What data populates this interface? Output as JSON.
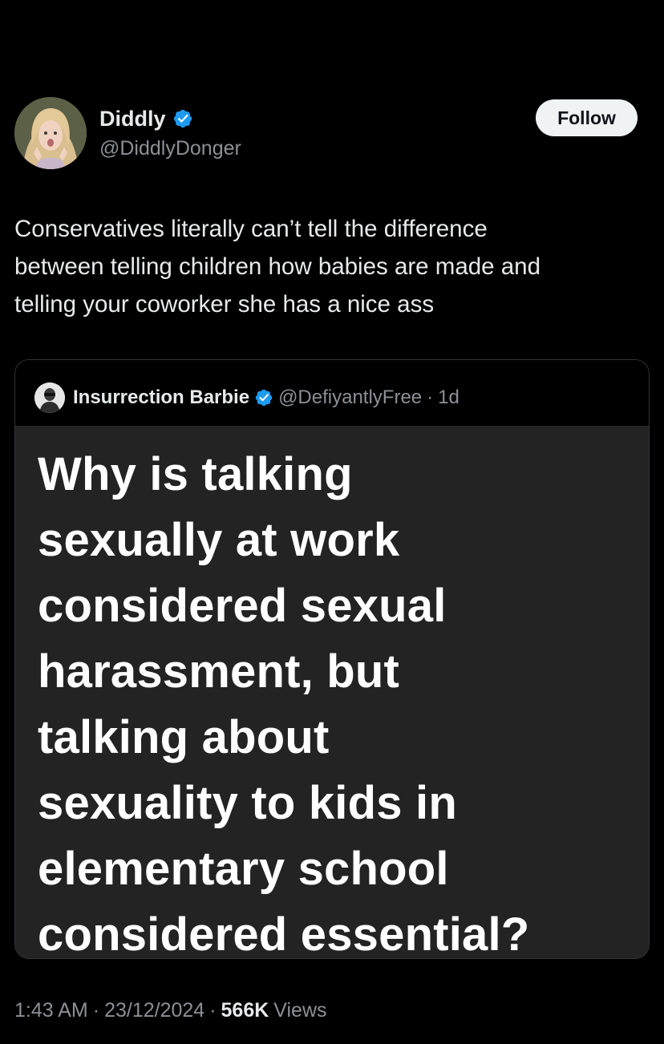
{
  "colors": {
    "background": "#000000",
    "text_primary": "#e7e9ea",
    "text_secondary": "#8b9096",
    "verified_badge": "#1d9bf0",
    "follow_button_bg": "#eff3f4",
    "quote_media_bg": "#232323"
  },
  "author": {
    "name": "Diddly",
    "handle": "@DiddlyDonger",
    "verified": true,
    "avatar_icon": "avatar-photo-icon"
  },
  "follow_button": {
    "label": "Follow"
  },
  "post": {
    "text": "Conservatives literally can’t tell the difference\nbetween telling children how babies are made and\ntelling your coworker she has a nice ass"
  },
  "quote": {
    "author_name": "Insurrection Barbie",
    "author_handle": "@DefiyantlyFree",
    "separator": "·",
    "time": "1d",
    "verified": true,
    "media_text": "Why is talking\nsexually at work\nconsidered sexual\nharassment, but\ntalking about\nsexuality to kids in\nelementary school\nconsidered essential?"
  },
  "footer": {
    "time": "1:43 AM",
    "separator": "·",
    "date": "23/12/2024",
    "views_count": "566K",
    "views_label": "Views"
  }
}
